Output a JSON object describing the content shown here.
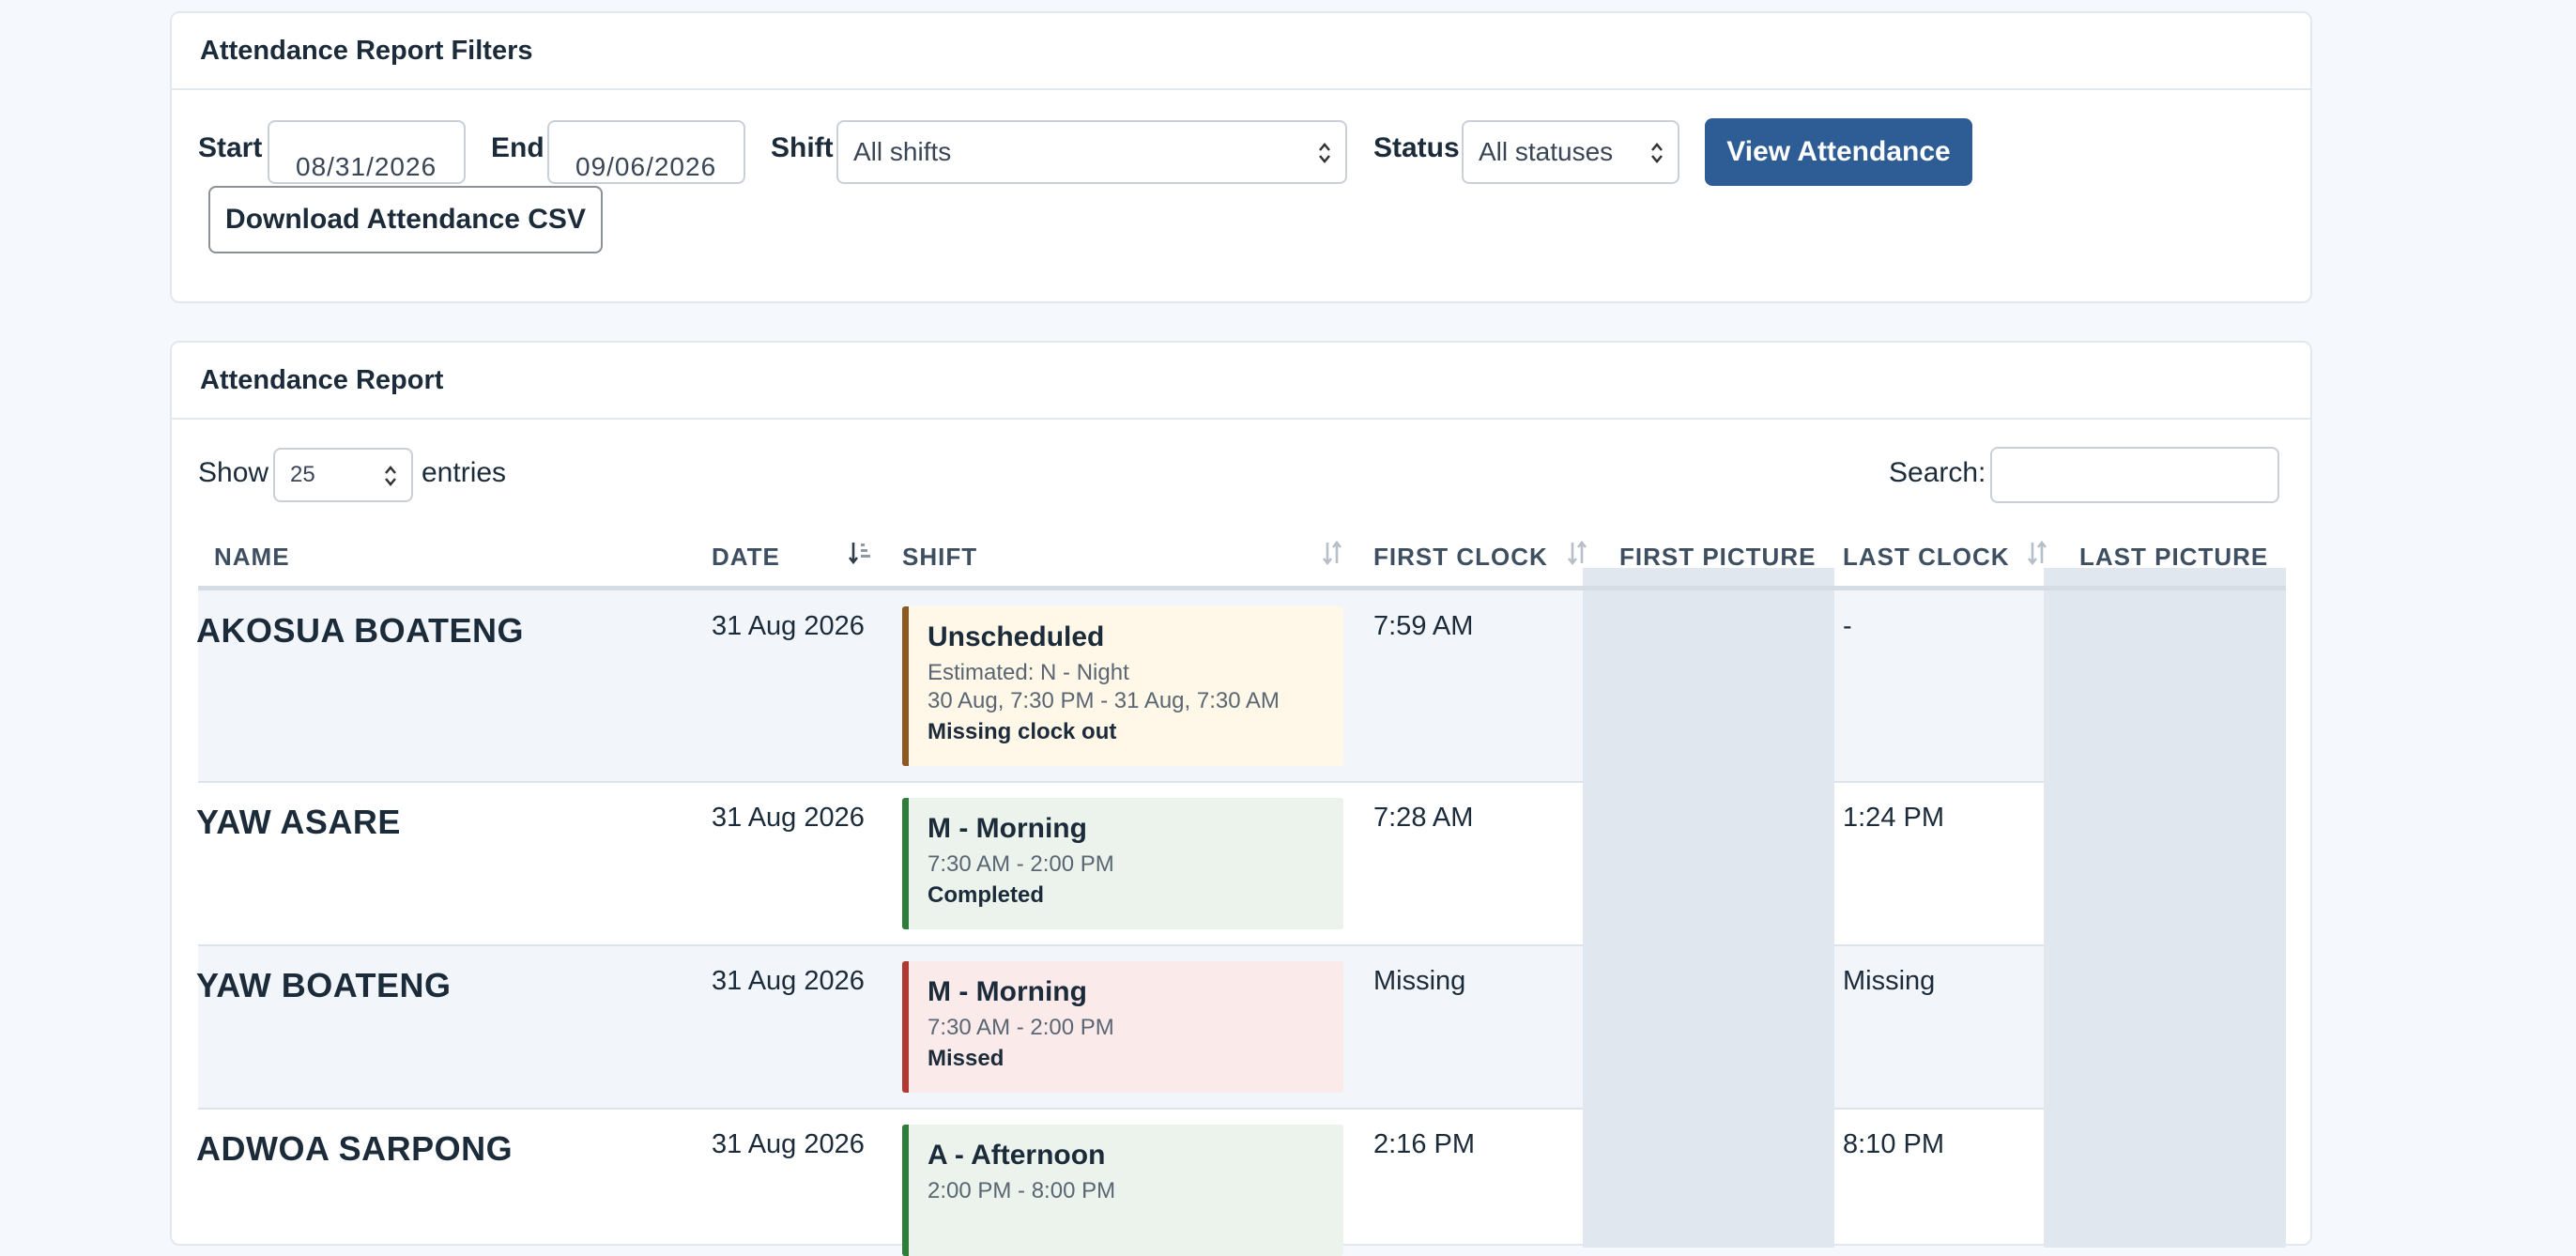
{
  "filters": {
    "title": "Attendance Report Filters",
    "start_label": "Start",
    "start_value": "08/31/2026",
    "end_label": "End",
    "end_value": "09/06/2026",
    "shift_label": "Shift",
    "shift_value": "All shifts",
    "status_label": "Status",
    "status_value": "All statuses",
    "view_button": "View Attendance",
    "download_button": "Download Attendance CSV"
  },
  "report": {
    "title": "Attendance Report",
    "show_label": "Show",
    "entries_value": "25",
    "entries_label": "entries",
    "search_label": "Search:",
    "search_value": "",
    "columns": [
      "NAME",
      "DATE",
      "SHIFT",
      "FIRST CLOCK",
      "FIRST PICTURE",
      "LAST CLOCK",
      "LAST PICTURE"
    ],
    "rows": [
      {
        "name": "AKOSUA BOATENG",
        "date": "31 Aug 2026",
        "shift_title": "Unscheduled",
        "shift_line1": "Estimated: N - Night",
        "shift_line2": "30 Aug, 7:30 PM - 31 Aug, 7:30 AM",
        "shift_status": "Missing clock out",
        "first_clock": "7:59 AM",
        "last_clock": "-"
      },
      {
        "name": "YAW ASARE",
        "date": "31 Aug 2026",
        "shift_title": "M - Morning",
        "shift_line1": "7:30 AM - 2:00 PM",
        "shift_status": "Completed",
        "first_clock": "7:28 AM",
        "last_clock": "1:24 PM"
      },
      {
        "name": "YAW BOATENG",
        "date": "31 Aug 2026",
        "shift_title": "M - Morning",
        "shift_line1": "7:30 AM - 2:00 PM",
        "shift_status": "Missed",
        "first_clock": "Missing",
        "last_clock": "Missing"
      },
      {
        "name": "ADWOA SARPONG",
        "date": "31 Aug 2026",
        "shift_title": "A - Afternoon",
        "shift_line1": "2:00 PM - 8:00 PM",
        "first_clock": "2:16 PM",
        "last_clock": "8:10 PM"
      }
    ]
  },
  "colors": {
    "primary_button": "#2e5d95",
    "unscheduled_accent": "#8a5a22",
    "completed_accent": "#2e7d3a",
    "missed_accent": "#b03a33",
    "picture_column": "#e1e7ef"
  }
}
